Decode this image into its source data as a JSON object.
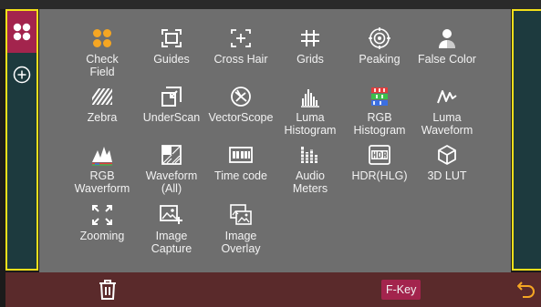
{
  "colors": {
    "accent_yellow": "#f3df1a",
    "active_magenta": "#a3244d",
    "panel_teal": "#1d3a3e",
    "grid_gray": "#6e6e6e",
    "bar_maroon": "#5a2a2b",
    "orange_icon": "#f5a623"
  },
  "left_panel": {
    "active_icon": "check-field-icon",
    "add_icon": "add-circle-icon"
  },
  "items": [
    {
      "label": "Check\nField",
      "icon": "check-field-icon"
    },
    {
      "label": "Guides",
      "icon": "guides-icon"
    },
    {
      "label": "Cross Hair",
      "icon": "cross-hair-icon"
    },
    {
      "label": "Grids",
      "icon": "grids-icon"
    },
    {
      "label": "Peaking",
      "icon": "peaking-icon"
    },
    {
      "label": "False Color",
      "icon": "false-color-icon"
    },
    {
      "label": "Zebra",
      "icon": "zebra-icon"
    },
    {
      "label": "UnderScan",
      "icon": "underscan-icon"
    },
    {
      "label": "VectorScope",
      "icon": "vectorscope-icon"
    },
    {
      "label": "Luma\nHistogram",
      "icon": "luma-histogram-icon"
    },
    {
      "label": "RGB\nHistogram",
      "icon": "rgb-histogram-icon"
    },
    {
      "label": "Luma\nWaveform",
      "icon": "luma-waveform-icon"
    },
    {
      "label": "RGB\nWaverform",
      "icon": "rgb-waveform-icon"
    },
    {
      "label": "Waveform\n(All)",
      "icon": "waveform-all-icon"
    },
    {
      "label": "Time code",
      "icon": "time-code-icon"
    },
    {
      "label": "Audio\nMeters",
      "icon": "audio-meters-icon"
    },
    {
      "label": "HDR(HLG)",
      "icon": "hdr-icon"
    },
    {
      "label": "3D LUT",
      "icon": "3d-lut-icon"
    },
    {
      "label": "Zooming",
      "icon": "zooming-icon"
    },
    {
      "label": "Image\nCapture",
      "icon": "image-capture-icon"
    },
    {
      "label": "Image\nOverlay",
      "icon": "image-overlay-icon"
    }
  ],
  "bottom_bar": {
    "trash_icon": "trash-icon",
    "fkey_label": "F-Key",
    "back_icon": "back-arrow-icon"
  }
}
